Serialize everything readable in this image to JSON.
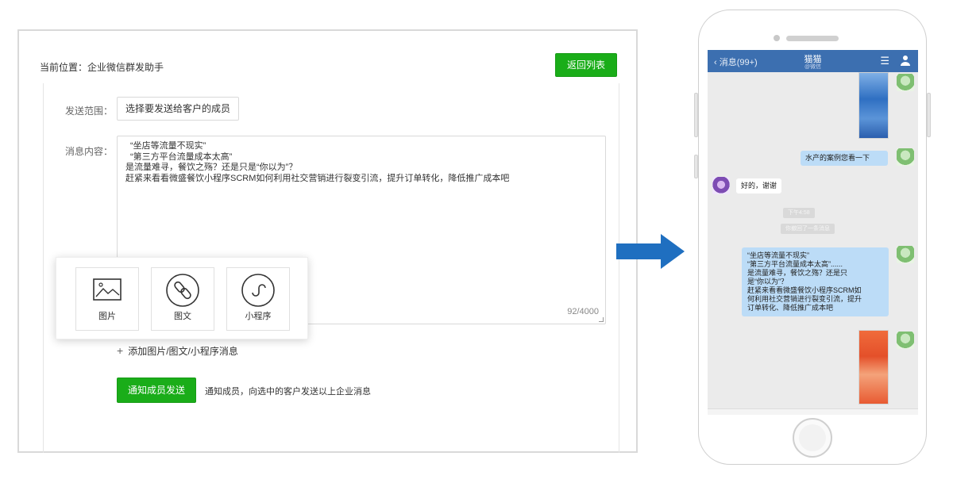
{
  "panel": {
    "breadcrumb_prefix": "当前位置：",
    "breadcrumb_current": "企业微信群发助手",
    "back_button": "返回列表",
    "target_label": "发送范围：",
    "target_value": "选择要发送给客户的成员",
    "content_label": "消息内容：",
    "content_lines": [
      "“坐店等流量不现实”",
      "“第三方平台流量成本太高”",
      "是流量难寻，餐饮之殇？还是只是“你以为”？",
      "赶紧来看看微盛餐饮小程序SCRM如何利用社交营销进行裂变引流，提升订单转化，降低推广成本吧"
    ],
    "counter": "92/4000",
    "popup": {
      "image_label": "图片",
      "article_label": "图文",
      "miniprogram_label": "小程序"
    },
    "add_link": "添加图片/图文/小程序消息",
    "notify_button": "通知成员发送",
    "notify_desc": "通知成员，向选中的客户发送以上企业消息"
  },
  "phone": {
    "back": "消息(99+)",
    "title": "猫猫",
    "subtitle": "@微信",
    "messages": {
      "m1": "水产的案例您看一下",
      "m2": "好的，谢谢",
      "sys1": "下午4:58",
      "sys2": "你撤回了一条消息",
      "m3_lines": [
        "“坐店等流量不现实”",
        "“第三方平台流量成本太高”......",
        "是流量难寻，餐饮之殇？还是只",
        "是“你以为”？",
        "赶紧来看看微盛餐饮小程序SCRM如",
        "何利用社交营销进行裂变引流，提升",
        "订单转化、降低推广成本吧"
      ]
    }
  },
  "colors": {
    "accent_green": "#1aad19",
    "arrow_blue": "#1f6fc0",
    "wechat_header": "#3c6fb0",
    "bubble_blue": "#bcdcf7"
  }
}
